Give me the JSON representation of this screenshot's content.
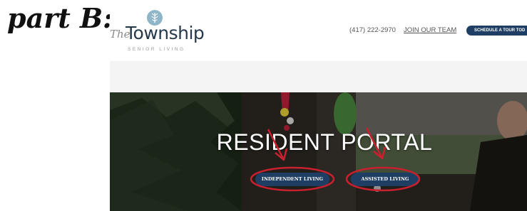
{
  "annotation": {
    "part_label": "part B:"
  },
  "header": {
    "logo": {
      "prefix": "The",
      "name": "Township",
      "subtitle": "SENIOR LIVING"
    },
    "phone": "(417) 222-2970",
    "join_link": "JOIN OUR TEAM",
    "schedule_button": "SCHEDULE A TOUR TOD"
  },
  "hero": {
    "title": "RESIDENT PORTAL",
    "buttons": {
      "independent": "INDEPENDENT LIVING",
      "assisted": "ASSISTED LIVING"
    }
  },
  "colors": {
    "brand_navy": "#1e3f63",
    "annotation_red": "#c8202e",
    "logo_blue": "#8fb5c9"
  },
  "icons": [
    "logo-leaf-icon",
    "annotation-arrow-icon",
    "annotation-circle-icon"
  ]
}
